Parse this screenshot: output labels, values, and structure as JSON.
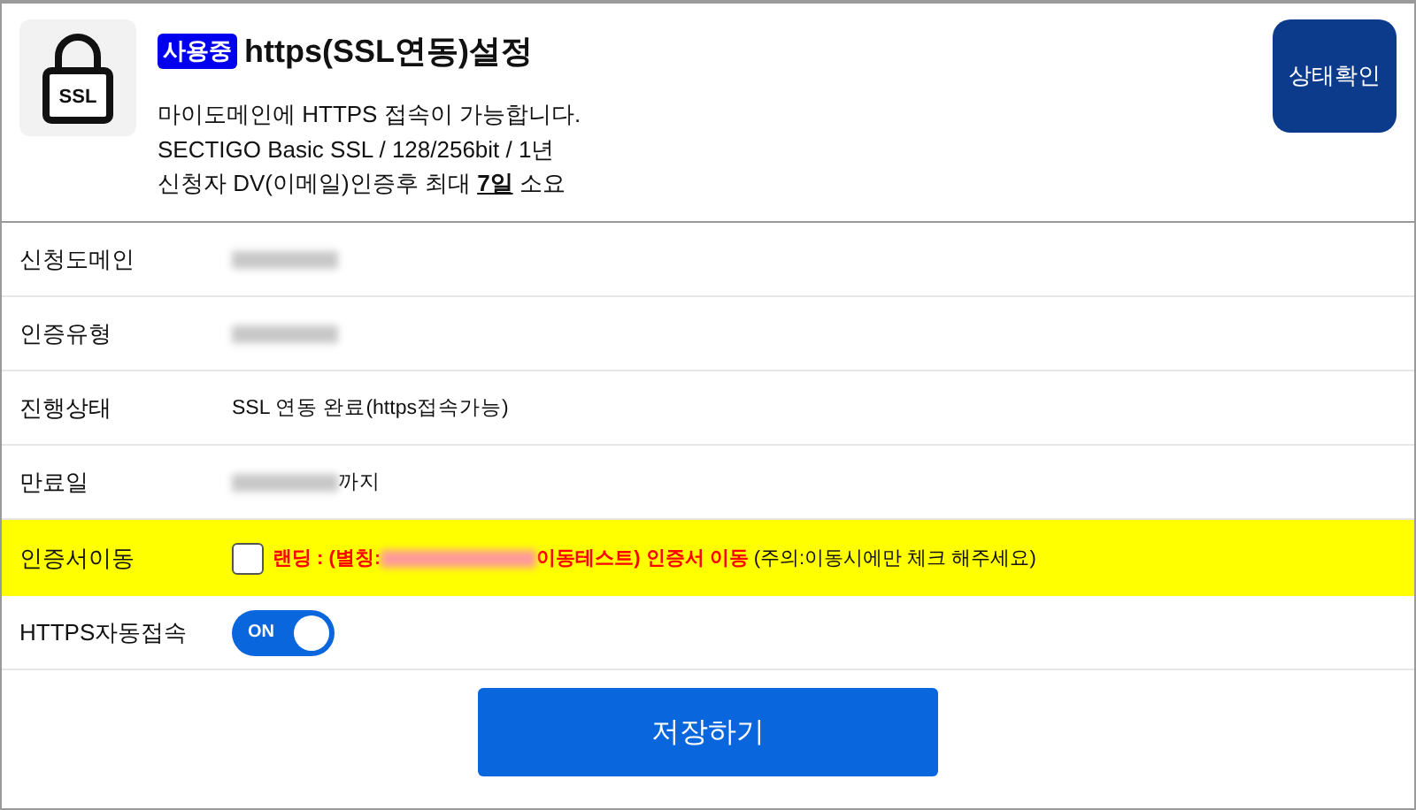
{
  "header": {
    "badge": "사용중",
    "title": "https(SSL연동)설정",
    "icon_label": "SSL",
    "lines": [
      {
        "text": "마이도메인에 HTTPS 접속이 가능합니다."
      },
      {
        "text": "SECTIGO Basic SSL / 128/256bit / 1년"
      },
      {
        "text": "신청자 DV(이메일)인증후 최대 ",
        "emphasis": "7일",
        "after": " 소요"
      }
    ],
    "status_button": "상태확인"
  },
  "rows": [
    {
      "kind": "redacted",
      "label": "신청도메인"
    },
    {
      "kind": "redacted",
      "label": "인증유형"
    },
    {
      "kind": "text",
      "label": "진행상태",
      "value": "SSL 연동 완료(https접속가능)"
    },
    {
      "kind": "redacted",
      "label": "만료일",
      "suffix": "까지"
    },
    {
      "kind": "checkbox",
      "label": "인증서이동",
      "highlighted": true,
      "checked": false,
      "before": "랜딩 : (별칭:",
      "after": "이동테스트) 인증서 이동",
      "note": "(주의:이동시에만 체크 해주세요)"
    },
    {
      "kind": "toggle",
      "label": "HTTPS자동접속",
      "on": true,
      "toggle_label": "ON"
    }
  ],
  "save_button": "저장하기"
}
